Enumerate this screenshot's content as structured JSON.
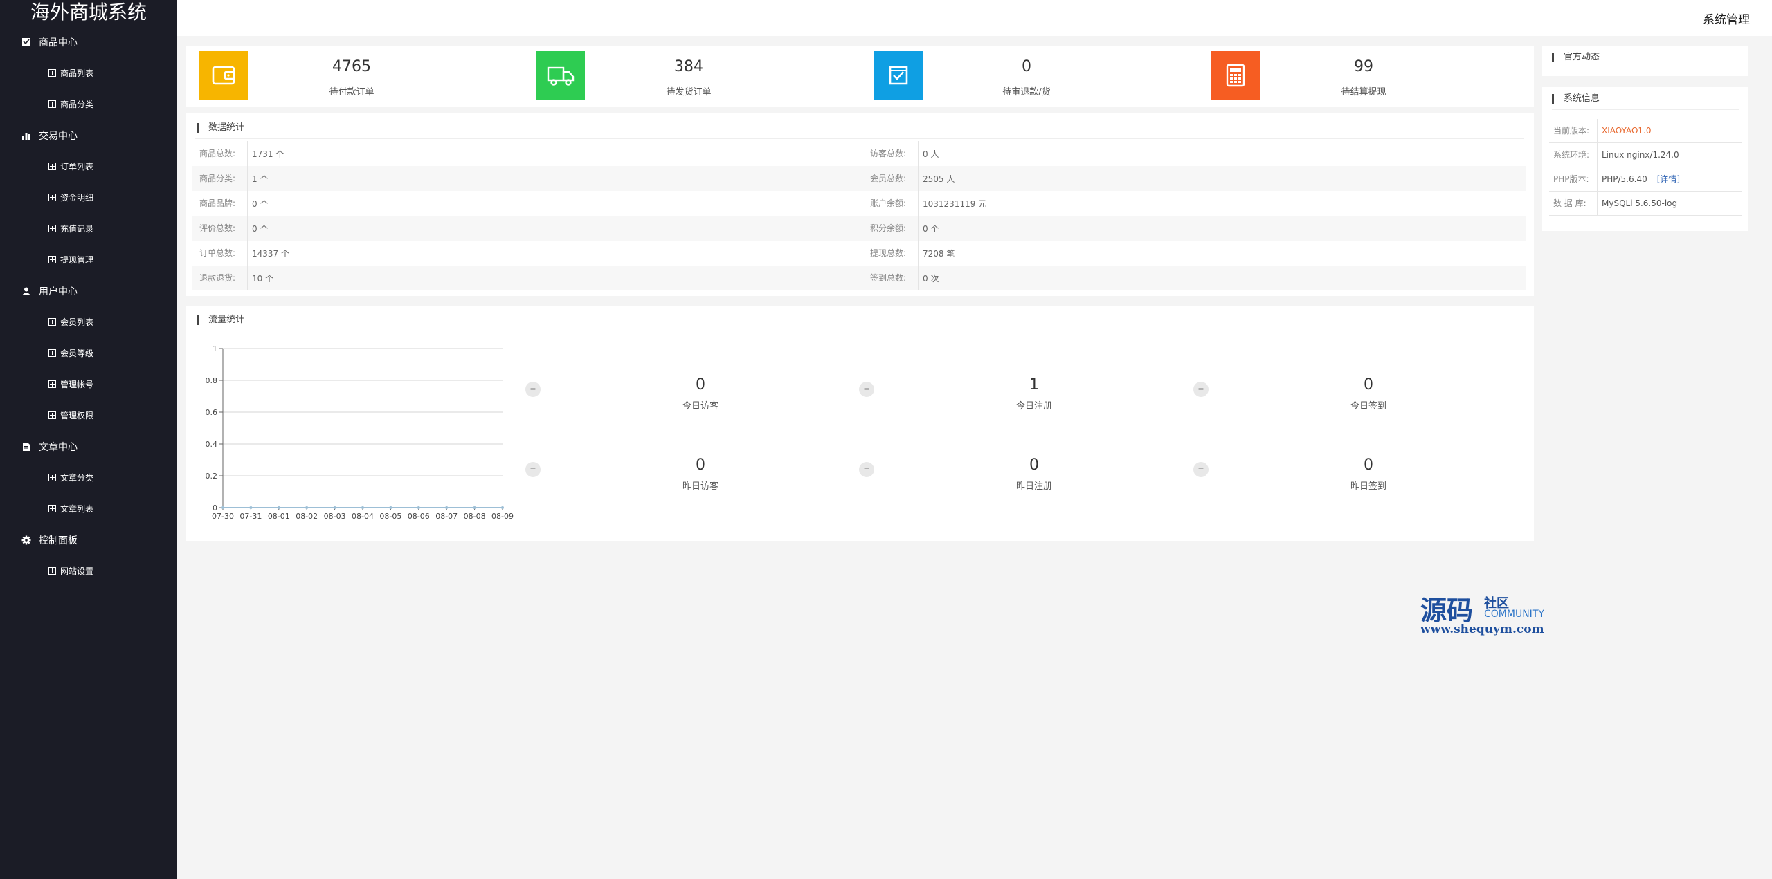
{
  "app": {
    "title": "海外商城系统",
    "user_menu": "系统管理"
  },
  "sidebar": {
    "groups": [
      {
        "label": "商品中心",
        "icon": "product-icon",
        "items": [
          "商品列表",
          "商品分类"
        ]
      },
      {
        "label": "交易中心",
        "icon": "bar-chart-icon",
        "items": [
          "订单列表",
          "资金明细",
          "充值记录",
          "提现管理"
        ]
      },
      {
        "label": "用户中心",
        "icon": "user-icon",
        "items": [
          "会员列表",
          "会员等级",
          "管理帐号",
          "管理权限"
        ]
      },
      {
        "label": "文章中心",
        "icon": "document-icon",
        "items": [
          "文章分类",
          "文章列表"
        ]
      },
      {
        "label": "控制面板",
        "icon": "gear-icon",
        "items": [
          "网站设置"
        ]
      }
    ]
  },
  "stats": [
    {
      "value": "4765",
      "label": "待付款订单",
      "color": "#f7b500",
      "icon": "wallet-icon"
    },
    {
      "value": "384",
      "label": "待发货订单",
      "color": "#2ecc52",
      "icon": "truck-icon"
    },
    {
      "value": "0",
      "label": "待审退款/货",
      "color": "#0f9fe3",
      "icon": "checkbox-icon"
    },
    {
      "value": "99",
      "label": "待结算提现",
      "color": "#f65d22",
      "icon": "calculator-icon"
    }
  ],
  "data_panel": {
    "title": "数据统计",
    "rows": [
      {
        "lk": "商品总数:",
        "lv": "1731 个",
        "rk": "访客总数:",
        "rv": "0 人"
      },
      {
        "lk": "商品分类:",
        "lv": "1 个",
        "rk": "会员总数:",
        "rv": "2505 人"
      },
      {
        "lk": "商品品牌:",
        "lv": "0 个",
        "rk": "账户余额:",
        "rv": "1031231119 元"
      },
      {
        "lk": "评价总数:",
        "lv": "0 个",
        "rk": "积分余额:",
        "rv": "0 个"
      },
      {
        "lk": "订单总数:",
        "lv": "14337 个",
        "rk": "提现总数:",
        "rv": "7208 笔"
      },
      {
        "lk": "退款退货:",
        "lv": "10 个",
        "rk": "签到总数:",
        "rv": "0 次"
      }
    ]
  },
  "traffic_panel": {
    "title": "流量统计",
    "kpis": [
      {
        "value": "0",
        "label": "今日访客",
        "dot": "="
      },
      {
        "value": "1",
        "label": "今日注册",
        "dot": "="
      },
      {
        "value": "0",
        "label": "今日签到",
        "dot": "="
      },
      {
        "value": "0",
        "label": "昨日访客",
        "dot": "="
      },
      {
        "value": "0",
        "label": "昨日注册",
        "dot": "="
      },
      {
        "value": "0",
        "label": "昨日签到",
        "dot": "="
      }
    ]
  },
  "chart_data": {
    "type": "line",
    "title": "",
    "xlabel": "",
    "ylabel": "",
    "categories": [
      "07-30",
      "07-31",
      "08-01",
      "08-02",
      "08-03",
      "08-04",
      "08-05",
      "08-06",
      "08-07",
      "08-08",
      "08-09"
    ],
    "series": [
      {
        "values": [
          0,
          0,
          0,
          0,
          0,
          0,
          0,
          0,
          0,
          0,
          0
        ]
      }
    ],
    "yticks": [
      "0",
      "0.2",
      "0.4",
      "0.6",
      "0.8",
      "1"
    ],
    "ylim": [
      0,
      1
    ],
    "grid": true,
    "line_color": "#9dbfd6"
  },
  "news_panel": {
    "title": "官方动态"
  },
  "sys_panel": {
    "title": "系统信息",
    "rows": [
      {
        "k": "当前版本:",
        "v": "XIAOYAO1.0"
      },
      {
        "k": "系统环境:",
        "v": "Linux nginx/1.24.0"
      },
      {
        "k": "PHP版本:",
        "v": "PHP/5.6.40",
        "link": "[详情]"
      },
      {
        "k": "数 据 库:",
        "v": "MySQLi 5.6.50-log"
      }
    ]
  },
  "watermark": {
    "big": "源码",
    "small1": "社区",
    "small2": "COMMUNITY",
    "url": "www.shequym.com"
  }
}
